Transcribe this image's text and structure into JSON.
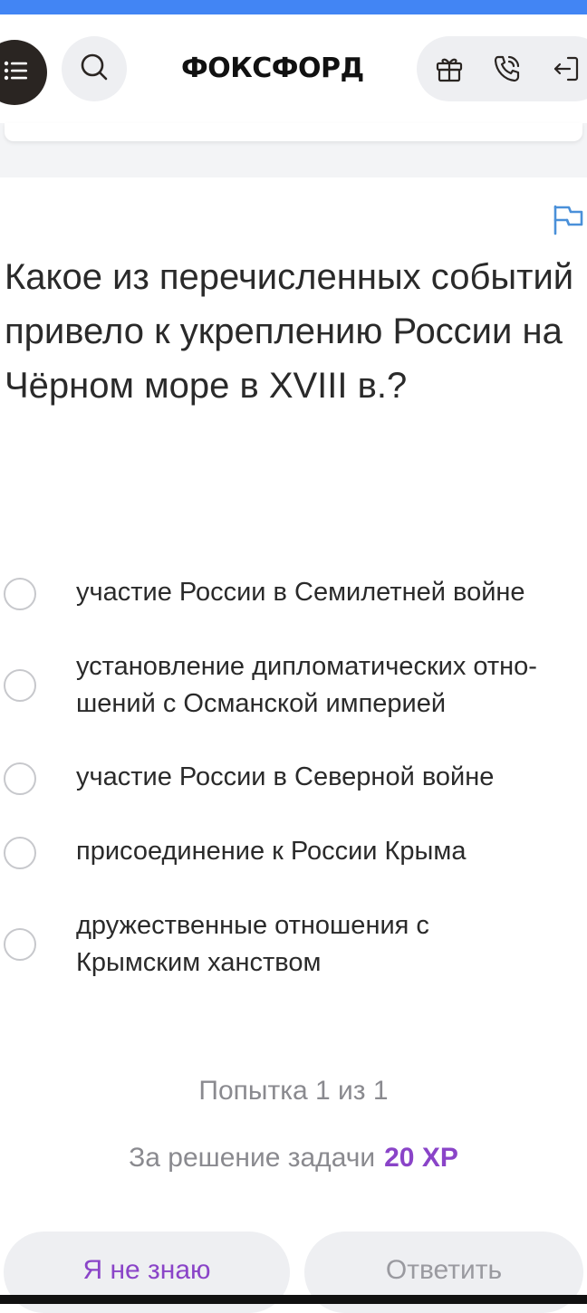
{
  "header": {
    "logo": "ФОКСФОРД",
    "icons": [
      "menu-icon",
      "search-icon",
      "gift-icon",
      "phone-icon",
      "logout-icon"
    ]
  },
  "task": {
    "question": "Какое из перечисленных событий привело к укреплению России на Чёрном море в XVIII в.?",
    "options": [
      {
        "line1": "участие России в Семилетней войне",
        "line2": ""
      },
      {
        "line1": "установление дипломатических отно-",
        "line2": "шений с Османской империей"
      },
      {
        "line1": "участие России в Северной войне",
        "line2": ""
      },
      {
        "line1": "присоединение к России Крыма",
        "line2": ""
      },
      {
        "line1": "дружественные отношения с",
        "line2": "Крымским ханством"
      }
    ]
  },
  "footer": {
    "attempt": "Попытка 1 из 1",
    "reward_label": "За решение задачи",
    "reward_value": "20 XP",
    "dont_know_label": "Я не знаю",
    "answer_label": "Ответить"
  },
  "colors": {
    "accent": "#8a44c8",
    "top_bar": "#4285f4",
    "flag": "#4a90d9",
    "pill_bg": "#eeeff2"
  }
}
